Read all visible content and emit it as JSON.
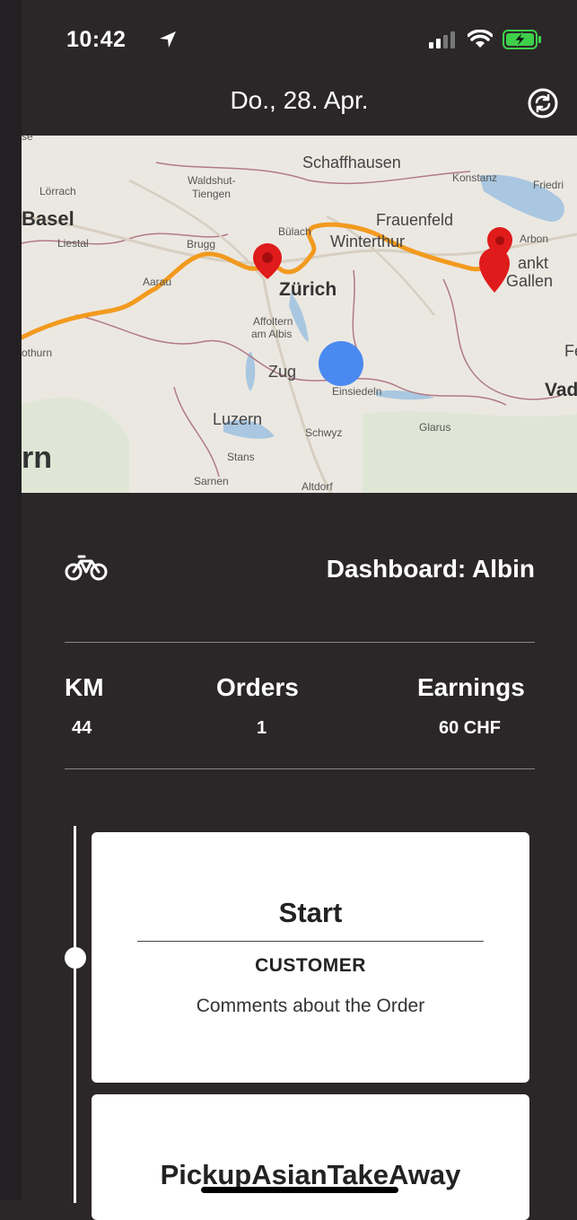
{
  "status": {
    "time": "10:42"
  },
  "header": {
    "date": "Do., 28. Apr."
  },
  "map": {
    "labels": {
      "schaffhausen": "Schaffhausen",
      "konstanz": "Konstanz",
      "friedrichshafen": "Friedri",
      "loerrach": "Lörrach",
      "waldshut": "Waldshut-",
      "tiengen": "Tiengen",
      "basel": "Basel",
      "liestal": "Liestal",
      "frauenfeld": "Frauenfeld",
      "arbon": "Arbon",
      "buelach": "Bülach",
      "winterthur": "Winterthur",
      "brugg": "Brugg",
      "aarau": "Aarau",
      "zuerich": "Zürich",
      "sankt": "ankt",
      "gallen": "Gallen",
      "affoltern1": "Affoltern",
      "affoltern2": "am Albis",
      "olothurn": "othurn",
      "zug": "Zug",
      "einsiedeln": "Einsiedeln",
      "fe": "Fe",
      "vad": "Vad",
      "luzern": "Luzern",
      "schwyz": "Schwyz",
      "glarus": "Glarus",
      "stans": "Stans",
      "rn": "rn",
      "sarnen": "Sarnen",
      "altdorf": "Altdorf",
      "se": "se"
    }
  },
  "dashboard": {
    "title": "Dashboard: Albin"
  },
  "stats": {
    "km_label": "KM",
    "km_value": "44",
    "orders_label": "Orders",
    "orders_value": "1",
    "earnings_label": "Earnings",
    "earnings_value": "60 CHF"
  },
  "cards": [
    {
      "title": "Start",
      "subtitle": "CUSTOMER",
      "text": "Comments about the Order"
    },
    {
      "title": "PickupAsianTakeAway"
    }
  ],
  "colors": {
    "route": "#f29a1e",
    "marker": "#e01b1b",
    "location": "#4a8af0",
    "background": "#2b2729"
  },
  "icons": {
    "sync": "sync-icon",
    "bike": "bicycle-icon",
    "location": "location-arrow-icon"
  }
}
